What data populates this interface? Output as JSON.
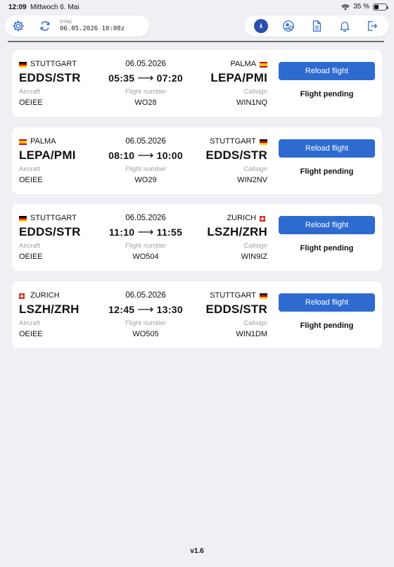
{
  "status_bar": {
    "time": "12:09",
    "date": "Mittwoch 6. Mai",
    "battery": "35 %",
    "battery_level": 0.35
  },
  "toolbar": {
    "sync_label": "SYNC",
    "sync_value": "06.05.2026 10:08z"
  },
  "colors": {
    "accent": "#2e6bd1",
    "background": "#eef0f4"
  },
  "flights": [
    {
      "dep_city": "STUTTGART",
      "dep_flag": "de",
      "dep_code": "EDDS/STR",
      "date": "06.05.2026",
      "dep_time": "05:35",
      "arr_time": "07:20",
      "arr_city": "PALMA",
      "arr_flag": "es",
      "arr_code": "LEPA/PMI",
      "aircraft_label": "Aircraft",
      "aircraft": "OEIEE",
      "flight_number_label": "Flight number",
      "flight_number": "WO28",
      "callsign_label": "Callsign",
      "callsign": "WIN1NQ",
      "button": "Reload flight",
      "status": "Flight pending"
    },
    {
      "dep_city": "PALMA",
      "dep_flag": "es",
      "dep_code": "LEPA/PMI",
      "date": "06.05.2026",
      "dep_time": "08:10",
      "arr_time": "10:00",
      "arr_city": "STUTTGART",
      "arr_flag": "de",
      "arr_code": "EDDS/STR",
      "aircraft_label": "Aircraft",
      "aircraft": "OEIEE",
      "flight_number_label": "Flight number",
      "flight_number": "WO29",
      "callsign_label": "Callsign",
      "callsign": "WIN2NV",
      "button": "Reload flight",
      "status": "Flight pending"
    },
    {
      "dep_city": "STUTTGART",
      "dep_flag": "de",
      "dep_code": "EDDS/STR",
      "date": "06.05.2026",
      "dep_time": "11:10",
      "arr_time": "11:55",
      "arr_city": "ZURICH",
      "arr_flag": "ch",
      "arr_code": "LSZH/ZRH",
      "aircraft_label": "Aircraft",
      "aircraft": "OEIEE",
      "flight_number_label": "Flight number",
      "flight_number": "WO504",
      "callsign_label": "Callsign",
      "callsign": "WIN9IZ",
      "button": "Reload flight",
      "status": "Flight pending"
    },
    {
      "dep_city": "ZURICH",
      "dep_flag": "ch",
      "dep_code": "LSZH/ZRH",
      "date": "06.05.2026",
      "dep_time": "12:45",
      "arr_time": "13:30",
      "arr_city": "STUTTGART",
      "arr_flag": "de",
      "arr_code": "EDDS/STR",
      "aircraft_label": "Aircraft",
      "aircraft": "OEIEE",
      "flight_number_label": "Flight number",
      "flight_number": "WO505",
      "callsign_label": "Callsign",
      "callsign": "WIN1DM",
      "button": "Reload flight",
      "status": "Flight pending"
    }
  ],
  "footer": {
    "version": "v1.6"
  }
}
